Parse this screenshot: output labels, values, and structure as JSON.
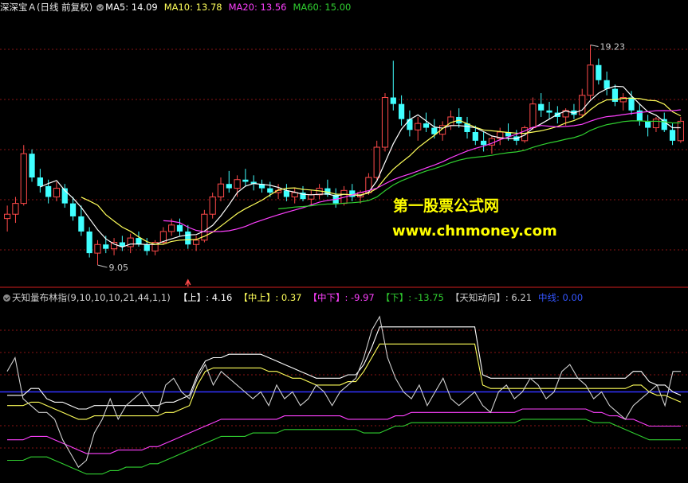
{
  "top_header": {
    "stock_title": "深深宝Ａ(日线 前复权)",
    "ma5": "MA5: 14.09",
    "ma10": "MA10: 13.78",
    "ma20": "MA20: 13.56",
    "ma60": "MA60: 15.00"
  },
  "bottom_header": {
    "indicator_name": "天知量布林指(9,10,10,10,21,44,1,1)",
    "up": "【上】: 4.16",
    "mid_up": "【中上】: 0.37",
    "mid_down": "【中下】: -9.97",
    "down": "【下】: -13.75",
    "tianzhi": "【天知动向】: 6.21",
    "midline": "中线: 0.00"
  },
  "watermark": {
    "line1": "第一股票公式网",
    "line2": "www.chnmoney.com"
  },
  "colors": {
    "background": "#000000",
    "grid": "#8a1414",
    "up_candle": "#ff4a4a",
    "down_candle": "#40ffff",
    "ma5": "#ffffff",
    "ma10": "#ffff5a",
    "ma20": "#ff40ff",
    "ma60": "#30d030",
    "midline": "#3333ff",
    "watermark": "#ffff00"
  },
  "chart_data": [
    {
      "type": "candlestick",
      "title": "深深宝Ａ(日线 前复权)",
      "annotations": [
        {
          "text": "19.23",
          "type": "high"
        },
        {
          "text": "9.05",
          "type": "low"
        }
      ],
      "ylim": [
        8.5,
        20.5
      ],
      "series": [
        {
          "name": "MA5",
          "value": 14.09
        },
        {
          "name": "MA10",
          "value": 13.78
        },
        {
          "name": "MA20",
          "value": 13.56
        },
        {
          "name": "MA60",
          "value": 15.0
        }
      ],
      "ohlc": [
        [
          11.2,
          11.8,
          10.6,
          11.4
        ],
        [
          11.4,
          12.2,
          11.0,
          11.9
        ],
        [
          11.9,
          14.6,
          11.8,
          14.2
        ],
        [
          14.2,
          14.4,
          12.9,
          13.1
        ],
        [
          13.1,
          13.5,
          12.4,
          12.7
        ],
        [
          12.7,
          13.0,
          11.9,
          12.2
        ],
        [
          12.2,
          12.9,
          12.0,
          12.6
        ],
        [
          12.6,
          12.8,
          11.7,
          11.9
        ],
        [
          11.9,
          12.2,
          11.1,
          11.3
        ],
        [
          11.3,
          11.8,
          10.4,
          10.6
        ],
        [
          10.6,
          10.8,
          9.4,
          9.6
        ],
        [
          9.6,
          10.2,
          9.05,
          10.0
        ],
        [
          10.0,
          10.4,
          9.6,
          9.8
        ],
        [
          9.8,
          10.3,
          9.5,
          10.1
        ],
        [
          10.1,
          10.4,
          9.7,
          9.9
        ],
        [
          9.9,
          10.5,
          9.6,
          10.3
        ],
        [
          10.3,
          10.6,
          9.9,
          10.0
        ],
        [
          10.0,
          10.3,
          9.5,
          9.7
        ],
        [
          9.7,
          10.2,
          9.5,
          10.1
        ],
        [
          10.1,
          10.8,
          10.0,
          10.6
        ],
        [
          10.6,
          11.2,
          10.4,
          10.9
        ],
        [
          10.9,
          11.2,
          10.4,
          10.6
        ],
        [
          10.6,
          10.9,
          9.8,
          10.0
        ],
        [
          10.0,
          10.4,
          9.7,
          10.2
        ],
        [
          10.2,
          11.6,
          10.1,
          11.4
        ],
        [
          11.4,
          12.4,
          11.2,
          12.2
        ],
        [
          12.2,
          13.1,
          12.0,
          12.8
        ],
        [
          12.8,
          13.4,
          12.4,
          12.6
        ],
        [
          12.6,
          13.2,
          12.2,
          13.0
        ],
        [
          13.0,
          13.5,
          12.7,
          12.9
        ],
        [
          12.9,
          13.2,
          12.5,
          12.8
        ],
        [
          12.8,
          13.0,
          12.4,
          12.6
        ],
        [
          12.6,
          12.9,
          12.2,
          12.4
        ],
        [
          12.4,
          12.8,
          12.1,
          12.5
        ],
        [
          12.5,
          12.8,
          12.0,
          12.2
        ],
        [
          12.2,
          12.6,
          11.9,
          12.4
        ],
        [
          12.4,
          12.7,
          12.0,
          12.1
        ],
        [
          12.1,
          12.5,
          11.8,
          12.3
        ],
        [
          12.3,
          12.8,
          12.1,
          12.6
        ],
        [
          12.6,
          13.0,
          12.2,
          12.3
        ],
        [
          12.3,
          12.6,
          11.7,
          11.9
        ],
        [
          11.9,
          12.7,
          11.8,
          12.5
        ],
        [
          12.5,
          12.8,
          12.0,
          12.2
        ],
        [
          12.2,
          12.5,
          11.9,
          12.4
        ],
        [
          12.4,
          13.3,
          12.3,
          13.1
        ],
        [
          13.1,
          14.8,
          13.0,
          14.5
        ],
        [
          14.5,
          17.0,
          14.3,
          16.8
        ],
        [
          16.8,
          18.5,
          16.2,
          16.5
        ],
        [
          16.5,
          16.9,
          15.5,
          15.8
        ],
        [
          15.8,
          16.2,
          15.0,
          15.3
        ],
        [
          15.3,
          15.9,
          14.8,
          15.6
        ],
        [
          15.6,
          16.1,
          15.2,
          15.4
        ],
        [
          15.4,
          15.8,
          14.9,
          15.1
        ],
        [
          15.1,
          15.7,
          14.8,
          15.5
        ],
        [
          15.5,
          16.2,
          15.3,
          15.9
        ],
        [
          15.9,
          16.3,
          15.4,
          15.6
        ],
        [
          15.6,
          15.9,
          14.9,
          15.2
        ],
        [
          15.2,
          15.5,
          14.6,
          14.8
        ],
        [
          14.8,
          15.2,
          14.3,
          14.6
        ],
        [
          14.6,
          15.0,
          14.2,
          14.9
        ],
        [
          14.9,
          15.4,
          14.6,
          15.2
        ],
        [
          15.2,
          15.6,
          14.8,
          15.0
        ],
        [
          15.0,
          15.3,
          14.6,
          14.8
        ],
        [
          14.8,
          15.5,
          14.7,
          15.4
        ],
        [
          15.4,
          16.8,
          15.3,
          16.5
        ],
        [
          16.5,
          17.0,
          15.9,
          16.2
        ],
        [
          16.2,
          16.6,
          15.8,
          16.1
        ],
        [
          16.1,
          16.4,
          15.6,
          15.9
        ],
        [
          15.9,
          16.3,
          15.5,
          16.2
        ],
        [
          16.2,
          16.5,
          15.8,
          16.0
        ],
        [
          16.0,
          17.2,
          15.9,
          16.9
        ],
        [
          16.9,
          19.23,
          16.7,
          18.3
        ],
        [
          18.3,
          18.6,
          17.4,
          17.6
        ],
        [
          17.6,
          18.0,
          16.9,
          17.2
        ],
        [
          17.2,
          17.4,
          16.4,
          16.6
        ],
        [
          16.6,
          17.0,
          16.2,
          16.8
        ],
        [
          16.8,
          17.1,
          16.0,
          16.2
        ],
        [
          16.2,
          16.5,
          15.5,
          15.7
        ],
        [
          15.7,
          16.0,
          15.0,
          15.4
        ],
        [
          15.4,
          15.9,
          15.2,
          15.8
        ],
        [
          15.8,
          16.1,
          15.2,
          15.3
        ],
        [
          15.3,
          15.6,
          14.6,
          14.8
        ],
        [
          14.8,
          15.9,
          14.7,
          15.7
        ]
      ]
    },
    {
      "type": "line",
      "title": "天知量布林指(9,10,10,10,21,44,1,1)",
      "series": [
        {
          "name": "上",
          "value": 4.16
        },
        {
          "name": "中上",
          "value": 0.37
        },
        {
          "name": "中下",
          "value": -9.97
        },
        {
          "name": "下",
          "value": -13.75
        },
        {
          "name": "天知动向",
          "value": 6.21
        },
        {
          "name": "中线",
          "value": 0.0
        }
      ],
      "ylim": [
        -25,
        25
      ],
      "up": [
        -1,
        -1,
        -1,
        1,
        1,
        -2,
        -3,
        -3,
        -4,
        -5,
        -5,
        -4,
        -4,
        -4,
        -4,
        -4,
        -4,
        -4,
        -4,
        -4,
        -3,
        -3,
        -2,
        -1,
        5,
        9,
        10,
        10,
        11,
        11,
        11,
        11,
        11,
        10,
        9,
        8,
        7,
        6,
        5,
        4,
        4,
        4,
        4,
        5,
        5,
        8,
        13,
        19,
        19,
        19,
        19,
        19,
        19,
        19,
        19,
        19,
        19,
        19,
        19,
        19,
        5,
        4,
        4,
        4,
        4,
        4,
        4,
        4,
        4,
        4,
        4,
        4,
        4,
        4,
        4,
        4,
        4,
        4,
        4,
        6,
        6,
        3,
        2,
        2,
        0,
        -1
      ],
      "mid_up": [
        -4,
        -4,
        -4,
        -3,
        -3,
        -4,
        -5,
        -6,
        -7,
        -8,
        -8,
        -7,
        -7,
        -7,
        -7,
        -7,
        -7,
        -7,
        -7,
        -7,
        -6,
        -6,
        -5,
        -4,
        2,
        6,
        7,
        7,
        7,
        7,
        7,
        7,
        7,
        6,
        6,
        5,
        4,
        4,
        3,
        2,
        2,
        2,
        2,
        3,
        3,
        6,
        10,
        14,
        14,
        14,
        14,
        14,
        14,
        14,
        14,
        14,
        14,
        14,
        14,
        14,
        2,
        1,
        1,
        1,
        1,
        1,
        1,
        1,
        1,
        1,
        1,
        1,
        1,
        1,
        1,
        1,
        1,
        1,
        1,
        2,
        2,
        0,
        -1,
        -1,
        -2,
        -3
      ],
      "mid_down": [
        -14,
        -14,
        -14,
        -13,
        -13,
        -13,
        -14,
        -15,
        -16,
        -17,
        -18,
        -18,
        -18,
        -18,
        -17,
        -17,
        -17,
        -17,
        -16,
        -16,
        -15,
        -14,
        -13,
        -12,
        -11,
        -10,
        -9,
        -8,
        -8,
        -8,
        -8,
        -8,
        -8,
        -8,
        -8,
        -7,
        -7,
        -7,
        -7,
        -7,
        -7,
        -7,
        -7,
        -8,
        -8,
        -8,
        -8,
        -8,
        -8,
        -7,
        -7,
        -6,
        -6,
        -6,
        -6,
        -6,
        -6,
        -6,
        -6,
        -6,
        -6,
        -6,
        -6,
        -6,
        -6,
        -5,
        -5,
        -5,
        -5,
        -5,
        -5,
        -5,
        -5,
        -5,
        -6,
        -6,
        -7,
        -7,
        -8,
        -8,
        -9,
        -10,
        -10,
        -10,
        -10,
        -10
      ],
      "down": [
        -20,
        -20,
        -20,
        -19,
        -19,
        -19,
        -20,
        -21,
        -22,
        -23,
        -24,
        -24,
        -24,
        -23,
        -23,
        -22,
        -22,
        -22,
        -21,
        -21,
        -20,
        -19,
        -18,
        -17,
        -16,
        -15,
        -14,
        -13,
        -13,
        -13,
        -13,
        -12,
        -12,
        -12,
        -12,
        -11,
        -11,
        -11,
        -11,
        -11,
        -11,
        -11,
        -11,
        -11,
        -11,
        -12,
        -12,
        -12,
        -11,
        -10,
        -10,
        -9,
        -9,
        -9,
        -9,
        -9,
        -9,
        -9,
        -9,
        -9,
        -9,
        -9,
        -9,
        -9,
        -9,
        -8,
        -8,
        -8,
        -8,
        -8,
        -8,
        -8,
        -8,
        -8,
        -9,
        -9,
        -9,
        -10,
        -11,
        -12,
        -13,
        -14,
        -14,
        -14,
        -14,
        -14
      ],
      "tianzhi": [
        6,
        10,
        -2,
        -4,
        -6,
        -6,
        -8,
        -14,
        -18,
        -22,
        -20,
        -12,
        -8,
        -2,
        -8,
        -4,
        -2,
        0,
        -4,
        -6,
        2,
        4,
        0,
        -2,
        4,
        8,
        2,
        6,
        4,
        2,
        0,
        -2,
        0,
        -4,
        2,
        -2,
        0,
        -4,
        -2,
        2,
        0,
        -4,
        0,
        2,
        4,
        10,
        18,
        22,
        10,
        4,
        0,
        -2,
        2,
        -4,
        0,
        4,
        -2,
        -4,
        -2,
        0,
        -4,
        -6,
        0,
        2,
        -2,
        0,
        4,
        2,
        -2,
        0,
        6,
        8,
        4,
        2,
        -2,
        0,
        -4,
        -6,
        -8,
        -4,
        -2,
        0,
        2,
        -4,
        6,
        6
      ]
    }
  ]
}
